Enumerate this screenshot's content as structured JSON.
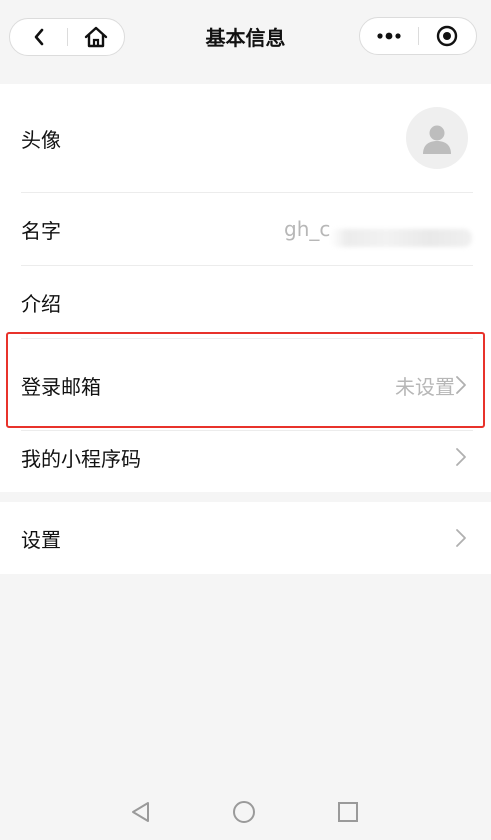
{
  "navbar": {
    "title": "基本信息"
  },
  "profile": {
    "avatar_label": "头像",
    "name_label": "名字",
    "name_value": "gh_c",
    "intro_label": "介绍",
    "email_label": "登录邮箱",
    "email_value": "未设置",
    "qrcode_label": "我的小程序码"
  },
  "settings": {
    "label": "设置"
  },
  "colors": {
    "accent_red": "#e8322b",
    "background": "#f5f5f5"
  },
  "icons": {
    "back": "back-icon",
    "home": "home-icon",
    "more": "more-icon",
    "target": "target-icon",
    "chevron": "chevron-right-icon",
    "avatar": "user-icon",
    "sys_back": "triangle-back-icon",
    "sys_home": "circle-home-icon",
    "sys_recent": "square-recent-icon"
  }
}
